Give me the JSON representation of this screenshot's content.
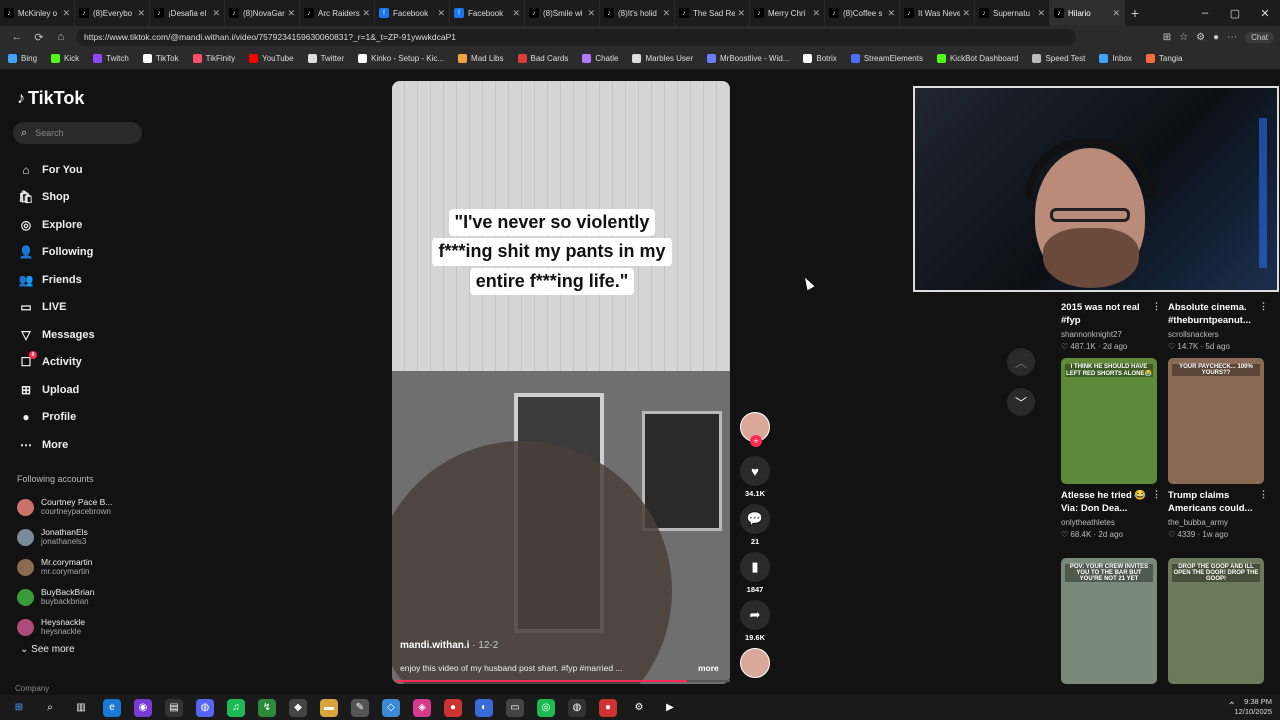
{
  "browser": {
    "tabs": [
      {
        "label": "McKinley o",
        "icon": "tiktok-icon"
      },
      {
        "label": "(8)Everybo",
        "icon": "tiktok-icon"
      },
      {
        "label": "¡Desafia el",
        "icon": "tiktok-icon"
      },
      {
        "label": "(8)NovaGar",
        "icon": "tiktok-icon"
      },
      {
        "label": "Arc Raiders",
        "icon": "tiktok-icon"
      },
      {
        "label": "Facebook",
        "icon": "facebook-icon"
      },
      {
        "label": "Facebook",
        "icon": "facebook-icon"
      },
      {
        "label": "(8)Smile wi",
        "icon": "tiktok-icon"
      },
      {
        "label": "(8)It's holid",
        "icon": "tiktok-icon"
      },
      {
        "label": "The Sad Re",
        "icon": "tiktok-icon"
      },
      {
        "label": "Merry Chri",
        "icon": "tiktok-icon"
      },
      {
        "label": "(8)Coffee s",
        "icon": "tiktok-icon"
      },
      {
        "label": "It Was Neve",
        "icon": "tiktok-icon"
      },
      {
        "label": "Supernatu",
        "icon": "tiktok-icon"
      },
      {
        "label": "Hilario",
        "icon": "tiktok-icon",
        "active": true
      }
    ],
    "url": "https://www.tiktok.com/@mandi.withan.i/video/7579234159630060831?_r=1&_t=ZP-91ywwkdcaP1",
    "chat_label": "Chat",
    "bookmarks": [
      {
        "label": "Bing",
        "color": "#3fa3ff"
      },
      {
        "label": "Kick",
        "color": "#53fc18"
      },
      {
        "label": "Twitch",
        "color": "#9146ff"
      },
      {
        "label": "TikTok",
        "color": "#ffffff"
      },
      {
        "label": "TikFinity",
        "color": "#ff4f6d"
      },
      {
        "label": "YouTube",
        "color": "#ff0000"
      },
      {
        "label": "Twitter",
        "color": "#dddddd"
      },
      {
        "label": "Kinko - Setup - Kic...",
        "color": "#ffffff"
      },
      {
        "label": "Mad Libs",
        "color": "#f2a33a"
      },
      {
        "label": "Bad Cards",
        "color": "#e03a3a"
      },
      {
        "label": "Chatle",
        "color": "#b07cff"
      },
      {
        "label": "Marbles User",
        "color": "#dddddd"
      },
      {
        "label": "MrBoostlive - Wid...",
        "color": "#6a7cff"
      },
      {
        "label": "Botrix",
        "color": "#ffffff"
      },
      {
        "label": "StreamElements",
        "color": "#4c6fff"
      },
      {
        "label": "KickBot Dashboard",
        "color": "#53fc18"
      },
      {
        "label": "Speed Test",
        "color": "#bbbbbb"
      },
      {
        "label": "Inbox",
        "color": "#3fa3ff"
      },
      {
        "label": "Tangia",
        "color": "#ff6a3a"
      }
    ]
  },
  "sidebar": {
    "logo": "TikTok",
    "search_placeholder": "Search",
    "nav": [
      {
        "label": "For You",
        "icon": "home-icon",
        "glyph": "⌂"
      },
      {
        "label": "Shop",
        "icon": "shop-icon",
        "glyph": "🛍"
      },
      {
        "label": "Explore",
        "icon": "compass-icon",
        "glyph": "◎"
      },
      {
        "label": "Following",
        "icon": "following-icon",
        "glyph": "👤"
      },
      {
        "label": "Friends",
        "icon": "friends-icon",
        "glyph": "👥"
      },
      {
        "label": "LIVE",
        "icon": "live-icon",
        "glyph": "▭"
      },
      {
        "label": "Messages",
        "icon": "messages-icon",
        "glyph": "▽"
      },
      {
        "label": "Activity",
        "icon": "activity-icon",
        "glyph": "☐",
        "badge": "8"
      },
      {
        "label": "Upload",
        "icon": "upload-icon",
        "glyph": "⊞"
      },
      {
        "label": "Profile",
        "icon": "profile-icon",
        "glyph": "●"
      },
      {
        "label": "More",
        "icon": "more-icon",
        "glyph": "⋯"
      }
    ],
    "following_title": "Following accounts",
    "following": [
      {
        "name": "Courtney Pace B...",
        "user": "courtneypacebrown",
        "color": "#c9726a"
      },
      {
        "name": "JonathanEls",
        "user": "jonathanels3",
        "color": "#7a8a99"
      },
      {
        "name": "Mr.corymartin",
        "user": "mr.corymartin",
        "color": "#8b6a4d"
      },
      {
        "name": "BuyBackBrian",
        "user": "buybackbrian",
        "color": "#3a9b3a"
      },
      {
        "name": "Heysnackle",
        "user": "heysnackle",
        "color": "#b04a7a"
      }
    ],
    "see_more": "See more",
    "company": "Company"
  },
  "video": {
    "caption_lines": [
      "\"I've never so violently",
      "f***ing shit my pants in my",
      "entire f***ing life.\""
    ],
    "username": "mandi.withan.i",
    "date": "· 12-2",
    "description": "enjoy this video of my husband post shart. #fyp #married ...",
    "more": "more",
    "progress": 0.87,
    "likes": "34.1K",
    "comments": "21",
    "saves": "1847",
    "shares": "19.6K"
  },
  "feed": [
    {
      "title": "2015 was not real #fyp",
      "channel": "shannonknight27",
      "likes": "487.1K",
      "age": "2d ago",
      "color": "#1a1a1a"
    },
    {
      "title": "Absolute cinema. #theburntpeanut...",
      "channel": "scrollsnackers",
      "likes": "14.7K",
      "age": "5d ago",
      "color": "#1a1a1a"
    },
    {
      "title": "Atlesse he tried 😂 Via: Don Dea...",
      "channel": "onlytheathletes",
      "likes": "68.4K",
      "age": "2d ago",
      "color": "#5f8a3a",
      "thumb_text": "I THINK HE SHOULD HAVE LEFT RED SHORTS ALONE😭"
    },
    {
      "title": "Trump claims Americans could...",
      "channel": "the_bubba_army",
      "likes": "4339",
      "age": "1w ago",
      "color": "#8a6a55",
      "thumb_text": "YOUR PAYCHECK... 100% YOURS??"
    },
    {
      "title": "",
      "channel": "",
      "likes": "",
      "age": "",
      "color": "#7a8a7a",
      "thumb_text": "POV: YOUR CREW INVITES YOU TO THE BAR BUT YOU'RE NOT 21 YET"
    },
    {
      "title": "",
      "channel": "",
      "likes": "",
      "age": "",
      "color": "#6a7a5a",
      "thumb_text": "DROP THE GOOP AND ILL OPEN THE DOOR! DROP THE GOOP!"
    }
  ],
  "taskbar": {
    "time": "9:38 PM",
    "date": "12/10/2025"
  },
  "colors": {
    "accent": "#fe2c55",
    "background": "#121212"
  }
}
